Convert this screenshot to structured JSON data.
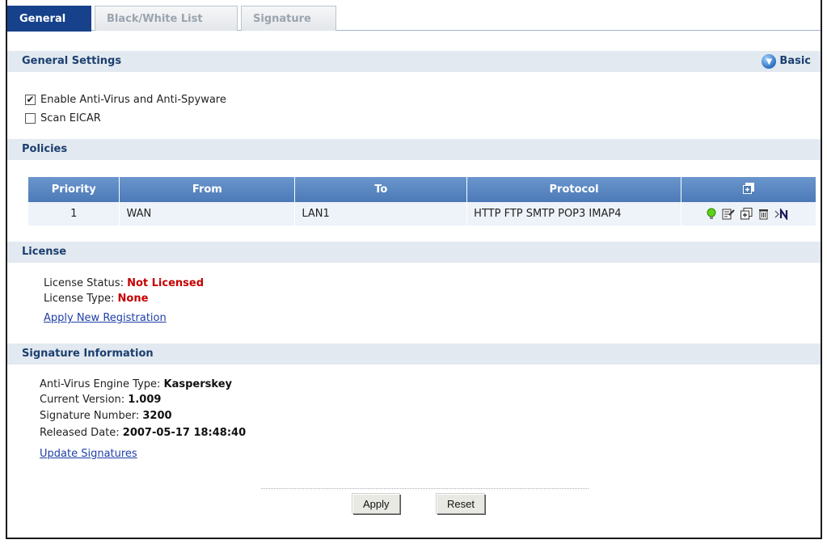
{
  "tabs": [
    {
      "label": "General",
      "active": true
    },
    {
      "label": "Black/White List",
      "active": false
    },
    {
      "label": "Signature",
      "active": false
    }
  ],
  "general": {
    "header": "General Settings",
    "basic_label": "Basic",
    "enable_av": {
      "label": "Enable Anti-Virus and Anti-Spyware",
      "checked": true
    },
    "scan_eicar": {
      "label": "Scan EICAR",
      "checked": false
    }
  },
  "policies": {
    "header": "Policies",
    "columns": [
      "Priority",
      "From",
      "To",
      "Protocol"
    ],
    "rows": [
      {
        "priority": "1",
        "from": "WAN",
        "to": "LAN1",
        "protocol": "HTTP FTP SMTP POP3 IMAP4"
      }
    ]
  },
  "license": {
    "header": "License",
    "status_label": "License Status:",
    "status_value": "Not Licensed",
    "type_label": "License Type:",
    "type_value": "None",
    "link": "Apply New Registration"
  },
  "signature": {
    "header": "Signature Information",
    "engine_label": "Anti-Virus Engine Type:",
    "engine_value": "Kasperskey",
    "version_label": "Current Version:",
    "version_value": "1.009",
    "number_label": "Signature Number:",
    "number_value": "3200",
    "date_label": "Released Date:",
    "date_value": "2007-05-17 18:48:40",
    "link": "Update Signatures"
  },
  "buttons": {
    "apply": "Apply",
    "reset": "Reset"
  },
  "colors": {
    "accent": "#17418b",
    "section_bg": "#e2e9f0",
    "table_header": "#5a86c0",
    "alert": "#c40000"
  }
}
